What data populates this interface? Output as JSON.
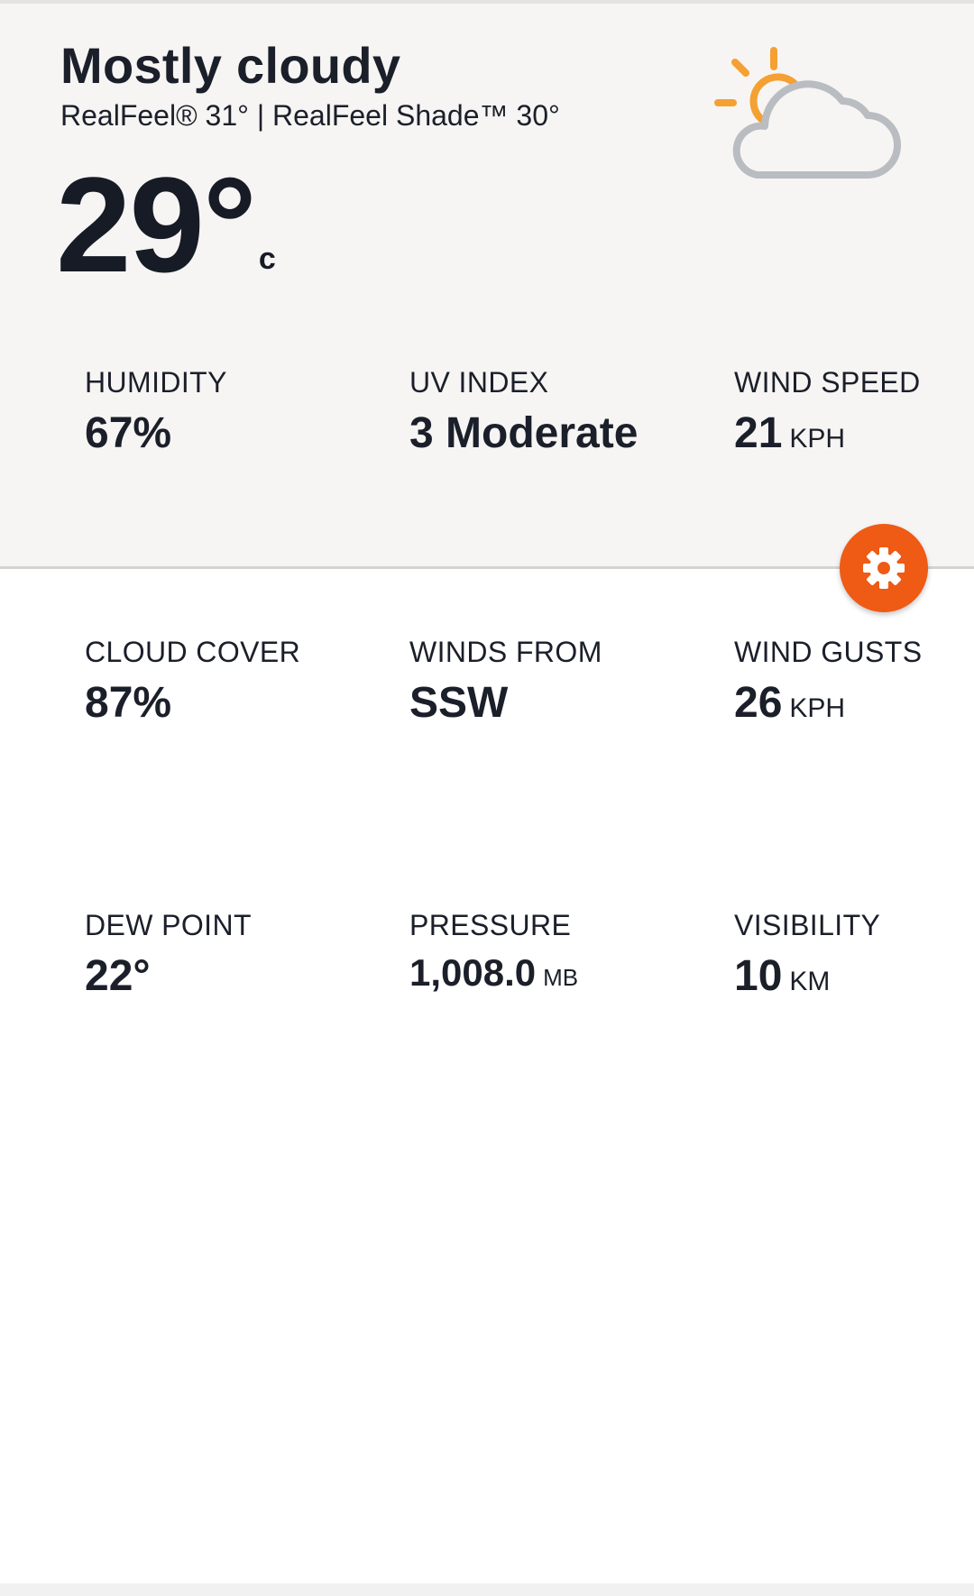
{
  "current": {
    "condition": "Mostly cloudy",
    "realfeel_line": "RealFeel® 31° | RealFeel Shade™ 30°",
    "temperature": "29°",
    "temperature_unit": "c",
    "icon": "partly-cloudy-icon"
  },
  "metrics": {
    "humidity": {
      "label": "HUMIDITY",
      "value": "67%",
      "unit": ""
    },
    "uv_index": {
      "label": "UV INDEX",
      "value": "3 Moderate",
      "unit": ""
    },
    "wind_speed": {
      "label": "WIND SPEED",
      "value": "21",
      "unit": "KPH"
    },
    "cloud_cover": {
      "label": "CLOUD COVER",
      "value": "87%",
      "unit": ""
    },
    "winds_from": {
      "label": "WINDS FROM",
      "value": "SSW",
      "unit": ""
    },
    "wind_gusts": {
      "label": "WIND GUSTS",
      "value": "26",
      "unit": "KPH"
    },
    "dew_point": {
      "label": "DEW POINT",
      "value": "22°",
      "unit": ""
    },
    "pressure": {
      "label": "PRESSURE",
      "value": "1,008.0",
      "unit": "MB"
    },
    "visibility": {
      "label": "VISIBILITY",
      "value": "10",
      "unit": "KM"
    }
  },
  "settings_button": {
    "icon": "gear-icon"
  },
  "colors": {
    "hero_background": "#f6f5f3",
    "accent_orange": "#ef5a14",
    "sun_orange": "#f5a032",
    "cloud_gray": "#b9bcc1",
    "text_dark": "#1b1f2a"
  }
}
